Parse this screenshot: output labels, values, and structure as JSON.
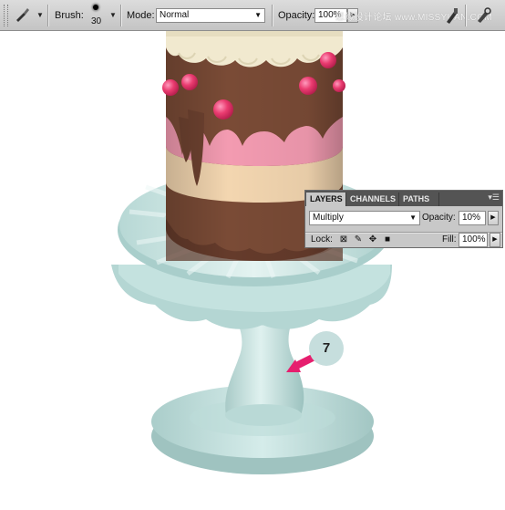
{
  "options_bar": {
    "brush_label": "Brush:",
    "brush_size": "30",
    "mode_label": "Mode:",
    "mode_value": "Normal",
    "opacity_label": "Opacity:",
    "opacity_value": "100%",
    "watermark": "思缘设计论坛 www.MISSYUAN.COM"
  },
  "layers_panel": {
    "tabs": [
      "LAYERS",
      "CHANNELS",
      "PATHS"
    ],
    "active_tab": "LAYERS",
    "blend_mode": "Multiply",
    "opacity_label": "Opacity:",
    "opacity_value": "10%",
    "lock_label": "Lock:",
    "fill_label": "Fill:",
    "fill_value": "100%"
  },
  "step_number": "7",
  "colors": {
    "stand": "#c9e6e3",
    "chocolate": "#7a4a35",
    "pink_layer": "#f29ab0",
    "cream_layer": "#f3d7b2",
    "berry": "#e8386b",
    "arrow": "#e61e6e"
  },
  "icons": [
    "brush-icon",
    "chevron-down-icon",
    "panel-menu-icon",
    "lock-transparent-icon",
    "lock-paint-icon",
    "lock-move-icon",
    "lock-all-icon",
    "arrow-pointer-icon"
  ]
}
